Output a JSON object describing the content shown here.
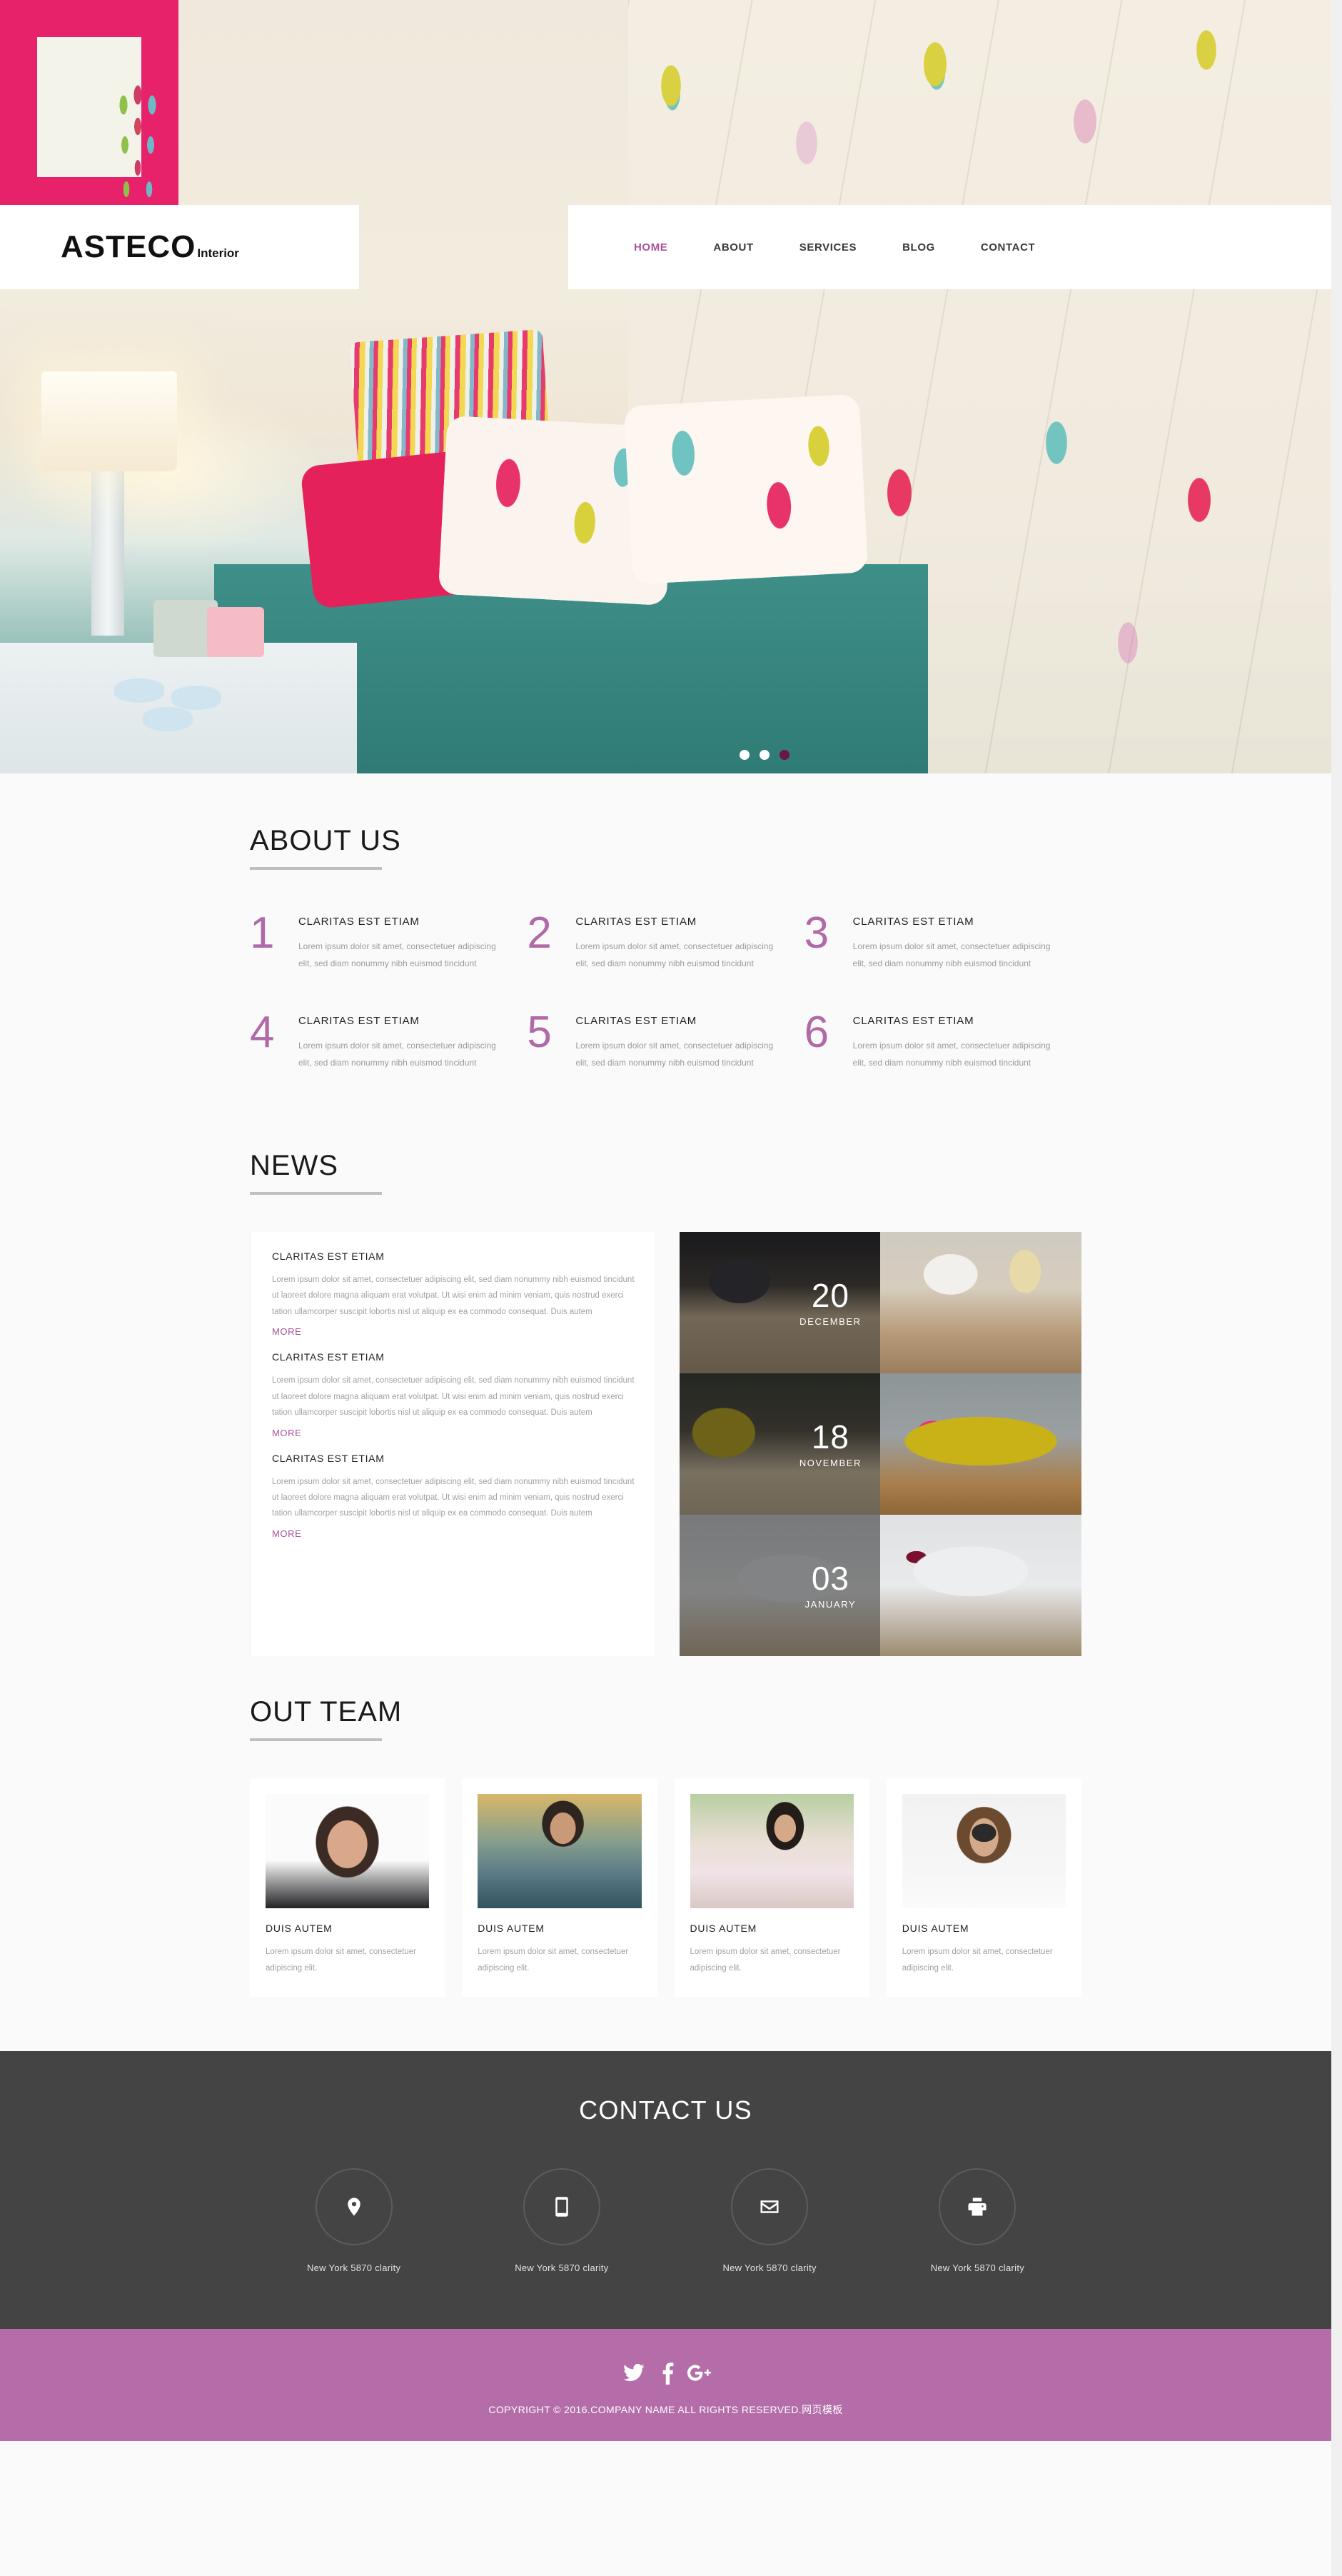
{
  "brand": {
    "name": "ASTECO",
    "tagline": "Interior"
  },
  "nav": {
    "items": [
      {
        "label": "HOME",
        "active": true
      },
      {
        "label": "ABOUT",
        "active": false
      },
      {
        "label": "SERVICES",
        "active": false
      },
      {
        "label": "BLOG",
        "active": false
      },
      {
        "label": "CONTACT",
        "active": false
      }
    ]
  },
  "hero": {
    "slides": 3,
    "active_slide": 3
  },
  "about": {
    "title": "ABOUT US",
    "items": [
      {
        "num": "1",
        "heading": "CLARITAS EST ETIAM",
        "text": "Lorem ipsum dolor sit amet, consectetuer adipiscing elit, sed diam nonummy nibh euismod tincidunt"
      },
      {
        "num": "2",
        "heading": "CLARITAS EST ETIAM",
        "text": "Lorem ipsum dolor sit amet, consectetuer adipiscing elit, sed diam nonummy nibh euismod tincidunt"
      },
      {
        "num": "3",
        "heading": "CLARITAS EST ETIAM",
        "text": "Lorem ipsum dolor sit amet, consectetuer adipiscing elit, sed diam nonummy nibh euismod tincidunt"
      },
      {
        "num": "4",
        "heading": "CLARITAS EST ETIAM",
        "text": "Lorem ipsum dolor sit amet, consectetuer adipiscing elit, sed diam nonummy nibh euismod tincidunt"
      },
      {
        "num": "5",
        "heading": "CLARITAS EST ETIAM",
        "text": "Lorem ipsum dolor sit amet, consectetuer adipiscing elit, sed diam nonummy nibh euismod tincidunt"
      },
      {
        "num": "6",
        "heading": "CLARITAS EST ETIAM",
        "text": "Lorem ipsum dolor sit amet, consectetuer adipiscing elit, sed diam nonummy nibh euismod tincidunt"
      }
    ]
  },
  "news": {
    "title": "NEWS",
    "items": [
      {
        "heading": "CLARITAS EST ETIAM",
        "text": "Lorem ipsum dolor sit amet, consectetuer adipiscing elit, sed diam nonummy nibh euismod tincidunt ut laoreet dolore magna aliquam erat volutpat. Ut wisi enim ad minim veniam, quis nostrud exerci tation ullamcorper suscipit lobortis nisl ut aliquip ex ea commodo consequat. Duis autem",
        "more": "MORE"
      },
      {
        "heading": "CLARITAS EST ETIAM",
        "text": "Lorem ipsum dolor sit amet, consectetuer adipiscing elit, sed diam nonummy nibh euismod tincidunt ut laoreet dolore magna aliquam erat volutpat. Ut wisi enim ad minim veniam, quis nostrud exerci tation ullamcorper suscipit lobortis nisl ut aliquip ex ea commodo consequat. Duis autem",
        "more": "MORE"
      },
      {
        "heading": "CLARITAS EST ETIAM",
        "text": "Lorem ipsum dolor sit amet, consectetuer adipiscing elit, sed diam nonummy nibh euismod tincidunt ut laoreet dolore magna aliquam erat volutpat. Ut wisi enim ad minim veniam, quis nostrud exerci tation ullamcorper suscipit lobortis nisl ut aliquip ex ea commodo consequat. Duis autem",
        "more": "MORE"
      }
    ],
    "gallery": [
      {
        "day": "20",
        "month": "DECEMBER"
      },
      {
        "day": "18",
        "month": "NOVEMBER"
      },
      {
        "day": "03",
        "month": "JANUARY"
      }
    ]
  },
  "team": {
    "title": "OUT TEAM",
    "members": [
      {
        "name": "DUIS AUTEM",
        "text": "Lorem ipsum dolor sit amet, consectetuer adipiscing elit."
      },
      {
        "name": "DUIS AUTEM",
        "text": "Lorem ipsum dolor sit amet, consectetuer adipiscing elit."
      },
      {
        "name": "DUIS AUTEM",
        "text": "Lorem ipsum dolor sit amet, consectetuer adipiscing elit."
      },
      {
        "name": "DUIS AUTEM",
        "text": "Lorem ipsum dolor sit amet, consectetuer adipiscing elit."
      }
    ]
  },
  "contact": {
    "title": "CONTACT US",
    "items": [
      {
        "icon": "map-pin-icon",
        "label": "New York 5870 clarity"
      },
      {
        "icon": "mobile-phone-icon",
        "label": "New York 5870 clarity"
      },
      {
        "icon": "envelope-icon",
        "label": "New York 5870 clarity"
      },
      {
        "icon": "printer-icon",
        "label": "New York 5870 clarity"
      }
    ]
  },
  "footer": {
    "social": [
      {
        "icon": "twitter-icon",
        "label": "Twitter"
      },
      {
        "icon": "facebook-icon",
        "label": "Facebook"
      },
      {
        "icon": "google-plus-icon",
        "label": "Google Plus"
      }
    ],
    "copyright": "COPYRIGHT © 2016.COMPANY NAME ALL RIGHTS RESERVED.网页模板"
  },
  "colors": {
    "accent_purple": "#a8539b",
    "number_purple": "#b06aa8",
    "footer_purple": "#b46da9",
    "contact_dark": "#444444",
    "page_bg": "#fafafa",
    "muted_text": "#a2a2a2"
  }
}
